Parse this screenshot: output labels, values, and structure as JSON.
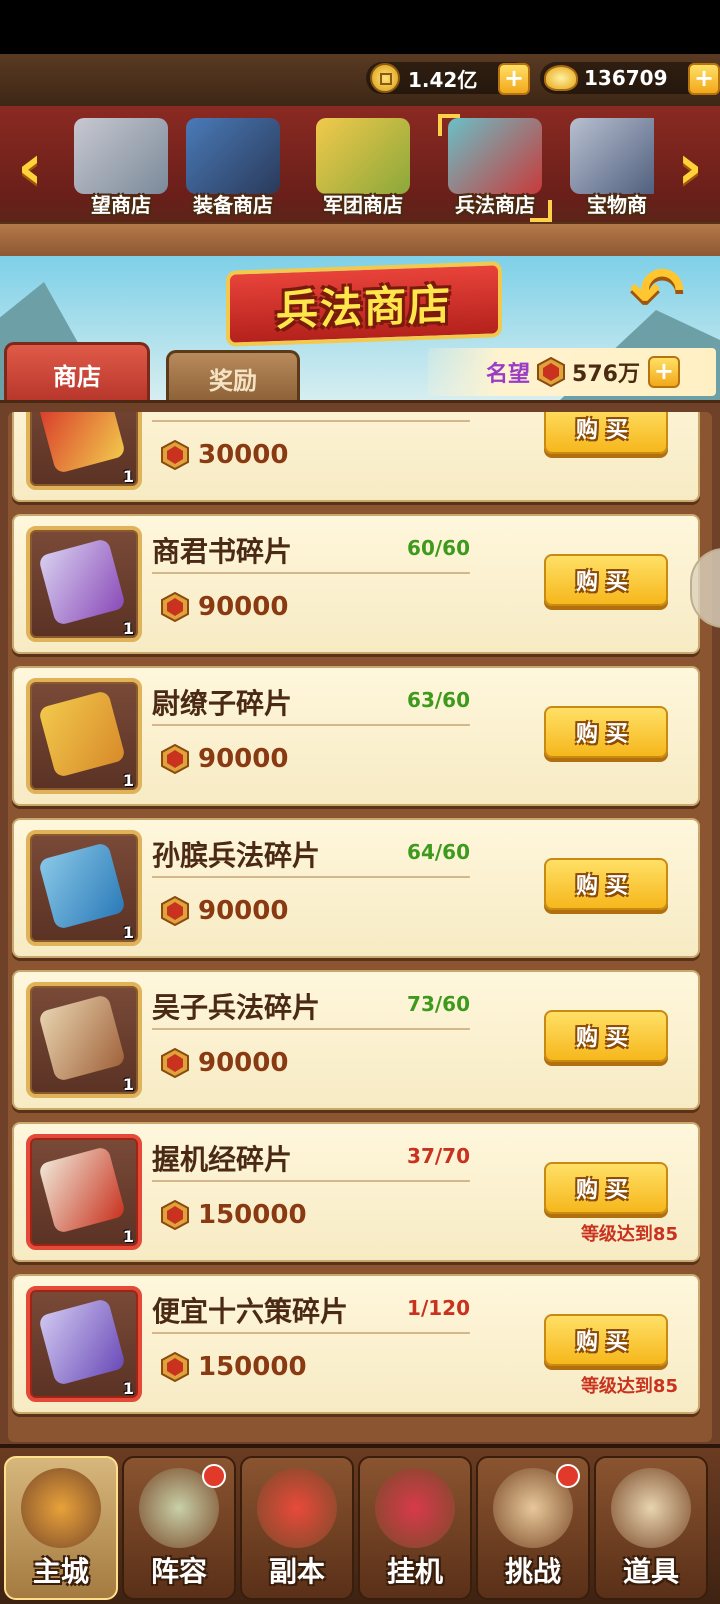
{
  "currency": {
    "coins": "1.42亿",
    "gold": "136709",
    "coin_icon": "copper-coin-icon",
    "gold_icon": "gold-ingot-icon"
  },
  "shop_tabs": [
    {
      "label": "望商店",
      "icon": "fame-shop-icon"
    },
    {
      "label": "装备商店",
      "icon": "armor-icon"
    },
    {
      "label": "军团商店",
      "icon": "legion-treasure-icon"
    },
    {
      "label": "兵法商店",
      "icon": "strategy-shop-icon",
      "active": true
    },
    {
      "label": "宝物商",
      "icon": "treasure-box-icon"
    }
  ],
  "page_title": "兵法商店",
  "subtabs": {
    "shop": "商店",
    "reward": "奖励"
  },
  "fame": {
    "label": "名望",
    "value": "576万"
  },
  "items": [
    {
      "name": "",
      "count": "",
      "price": "30000",
      "qty": "1",
      "buy_label": "购买",
      "frame": "gold",
      "requirement": ""
    },
    {
      "name": "商君书碎片",
      "count": "60/60",
      "count_color": "green",
      "price": "90000",
      "qty": "1",
      "buy_label": "购买",
      "frame": "gold",
      "requirement": ""
    },
    {
      "name": "尉缭子碎片",
      "count": "63/60",
      "count_color": "green",
      "price": "90000",
      "qty": "1",
      "buy_label": "购买",
      "frame": "gold",
      "requirement": ""
    },
    {
      "name": "孙膑兵法碎片",
      "count": "64/60",
      "count_color": "green",
      "price": "90000",
      "qty": "1",
      "buy_label": "购买",
      "frame": "gold",
      "requirement": ""
    },
    {
      "name": "吴子兵法碎片",
      "count": "73/60",
      "count_color": "green",
      "price": "90000",
      "qty": "1",
      "buy_label": "购买",
      "frame": "gold",
      "requirement": ""
    },
    {
      "name": "握机经碎片",
      "count": "37/70",
      "count_color": "red",
      "price": "150000",
      "qty": "1",
      "buy_label": "购买",
      "frame": "red",
      "requirement": "等级达到85"
    },
    {
      "name": "便宜十六策碎片",
      "count": "1/120",
      "count_color": "red",
      "price": "150000",
      "qty": "1",
      "buy_label": "购买",
      "frame": "red",
      "requirement": "等级达到85"
    }
  ],
  "nav": [
    {
      "label": "主城",
      "active": true,
      "badge": false
    },
    {
      "label": "阵容",
      "active": false,
      "badge": true
    },
    {
      "label": "副本",
      "active": false,
      "badge": false
    },
    {
      "label": "挂机",
      "active": false,
      "badge": false
    },
    {
      "label": "挑战",
      "active": false,
      "badge": true
    },
    {
      "label": "道具",
      "active": false,
      "badge": false
    }
  ],
  "colors": {
    "count_green": "#3e9a1c",
    "count_red": "#c8321e",
    "fame_label": "#9a3cc6"
  }
}
